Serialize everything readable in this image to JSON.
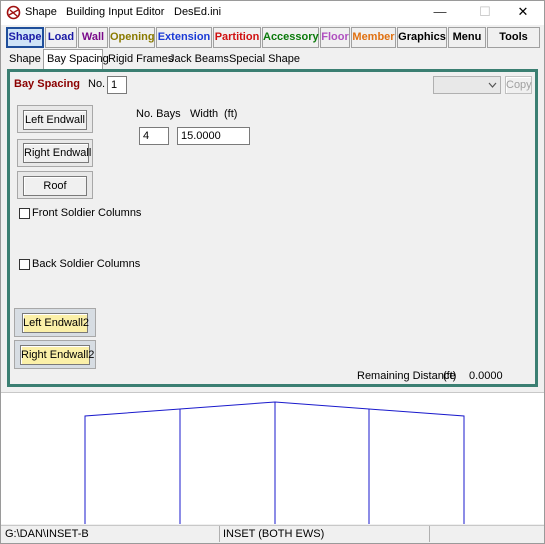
{
  "window": {
    "app_title": "Shape",
    "editor_title": "Building Input Editor",
    "file_name": "DesEd.ini",
    "minimize_glyph": "—",
    "maximize_glyph": "☐",
    "close_glyph": "✕",
    "icon": "app-logo-icon"
  },
  "menu": [
    {
      "label": "Shape",
      "color": "#1a1aa6"
    },
    {
      "label": "Load",
      "color": "#1a1aa6"
    },
    {
      "label": "Wall",
      "color": "#7a0a8a"
    },
    {
      "label": "Opening",
      "color": "#8a7a00"
    },
    {
      "label": "Extension",
      "color": "#1a3ad6"
    },
    {
      "label": "Partition",
      "color": "#d01010"
    },
    {
      "label": "Accessory",
      "color": "#0a7a0a"
    },
    {
      "label": "Floor",
      "color": "#b050c0"
    },
    {
      "label": "Member",
      "color": "#e07010"
    },
    {
      "label": "Graphics",
      "color": "#000000"
    },
    {
      "label": "Menu",
      "color": "#000000"
    },
    {
      "label": "Tools",
      "color": "#000000"
    }
  ],
  "tabs": [
    "Shape",
    "Bay Spacing",
    "Rigid Frames",
    "Jack Beams",
    "Special Shape"
  ],
  "active_tab": "Bay Spacing",
  "panel": {
    "title": "Bay Spacing",
    "title_color": "#8b0000",
    "no_label": "No.",
    "no_value": "1",
    "copy_label": "Copy",
    "dropdown_value": "",
    "buttons": {
      "left_endwall": "Left Endwall",
      "right_endwall": "Right Endwall",
      "roof": "Roof",
      "left_endwall2": "Left Endwall2",
      "right_endwall2": "Right Endwall2"
    },
    "front_soldier_columns": {
      "label": "Front Soldier Columns",
      "checked": false
    },
    "back_soldier_columns": {
      "label": "Back Soldier Columns",
      "checked": false
    },
    "no_bays_label": "No. Bays",
    "width_label": "Width",
    "width_unit": "(ft)",
    "no_bays_value": "4",
    "width_value": "15.0000",
    "remaining_label": "Remaining Distance",
    "remaining_unit": "(ft)",
    "remaining_value": "0.0000"
  },
  "status": {
    "path": "G:\\DAN\\INSET-B",
    "mode": "INSET (BOTH EWS)"
  },
  "frame_color": "#1a1acc"
}
